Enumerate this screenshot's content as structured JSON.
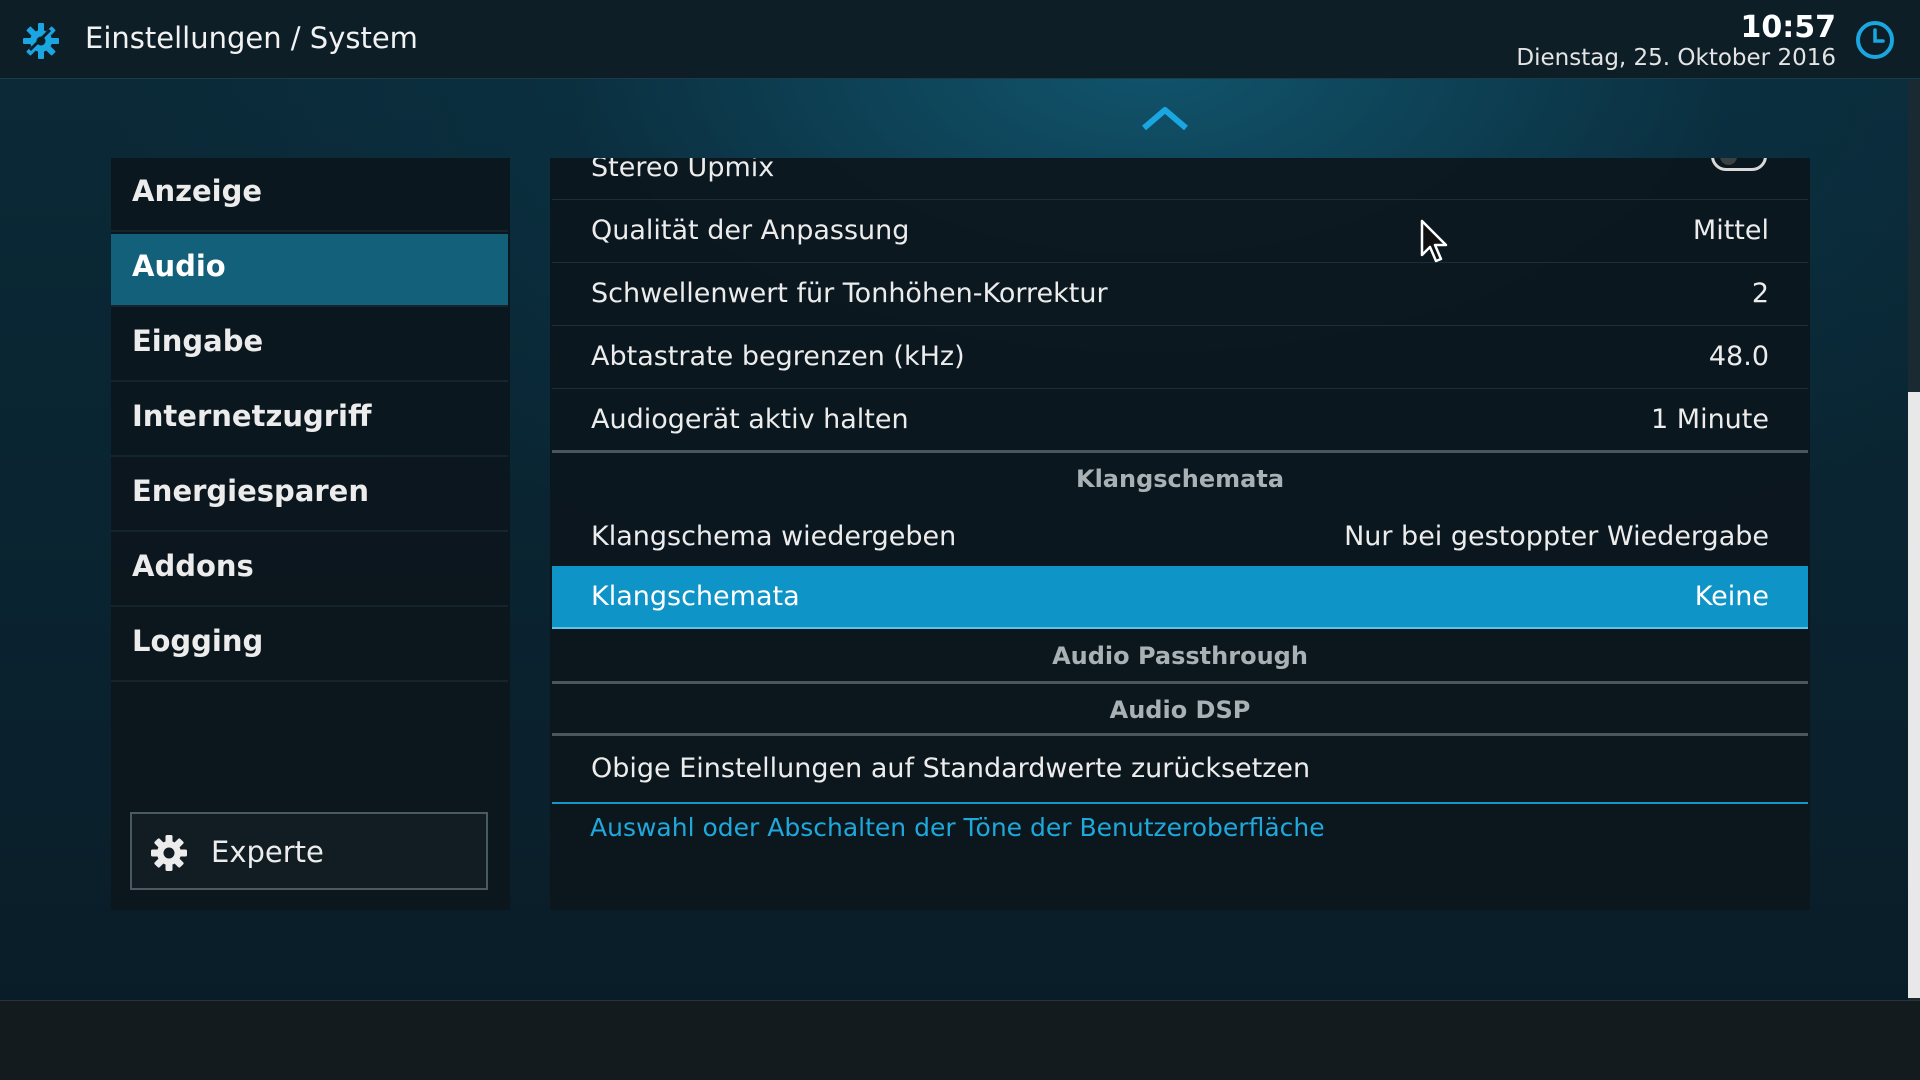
{
  "header": {
    "title": "Einstellungen / System",
    "time": "10:57",
    "date": "Dienstag, 25. Oktober 2016",
    "app_icon": "settings-gear-icon",
    "clock_icon": "clock-icon"
  },
  "sidebar": {
    "items": [
      {
        "label": "Anzeige",
        "active": false
      },
      {
        "label": "Audio",
        "active": true
      },
      {
        "label": "Eingabe",
        "active": false
      },
      {
        "label": "Internetzugriff",
        "active": false
      },
      {
        "label": "Energiesparen",
        "active": false
      },
      {
        "label": "Addons",
        "active": false
      },
      {
        "label": "Logging",
        "active": false
      }
    ],
    "level_button": {
      "label": "Experte",
      "icon": "gear-icon"
    }
  },
  "settings": {
    "partial_row": {
      "label": "Stereo Upmix",
      "toggle_on": false
    },
    "rows": [
      {
        "label": "Qualität der Anpassung",
        "value": "Mittel"
      },
      {
        "label": "Schwellenwert für Tonhöhen-Korrektur",
        "value": "2"
      },
      {
        "label": "Abtastrate begrenzen (kHz)",
        "value": "48.0"
      },
      {
        "label": "Audiogerät aktiv halten",
        "value": "1 Minute"
      }
    ],
    "section_sounds": "Klangschemata",
    "sound_rows": [
      {
        "label": "Klangschema wiedergeben",
        "value": "Nur bei gestoppter Wiedergabe"
      },
      {
        "label": "Klangschemata",
        "value": "Keine",
        "selected": true
      }
    ],
    "section_passthrough": "Audio Passthrough",
    "section_dsp": "Audio DSP",
    "reset_label": "Obige Einstellungen auf Standardwerte zurücksetzen",
    "description": "Auswahl oder Abschalten der Töne der Benutzeroberfläche"
  },
  "colors": {
    "accent": "#0f94c8",
    "sidebar_active": "#12607a",
    "description_text": "#1ea8dc"
  }
}
